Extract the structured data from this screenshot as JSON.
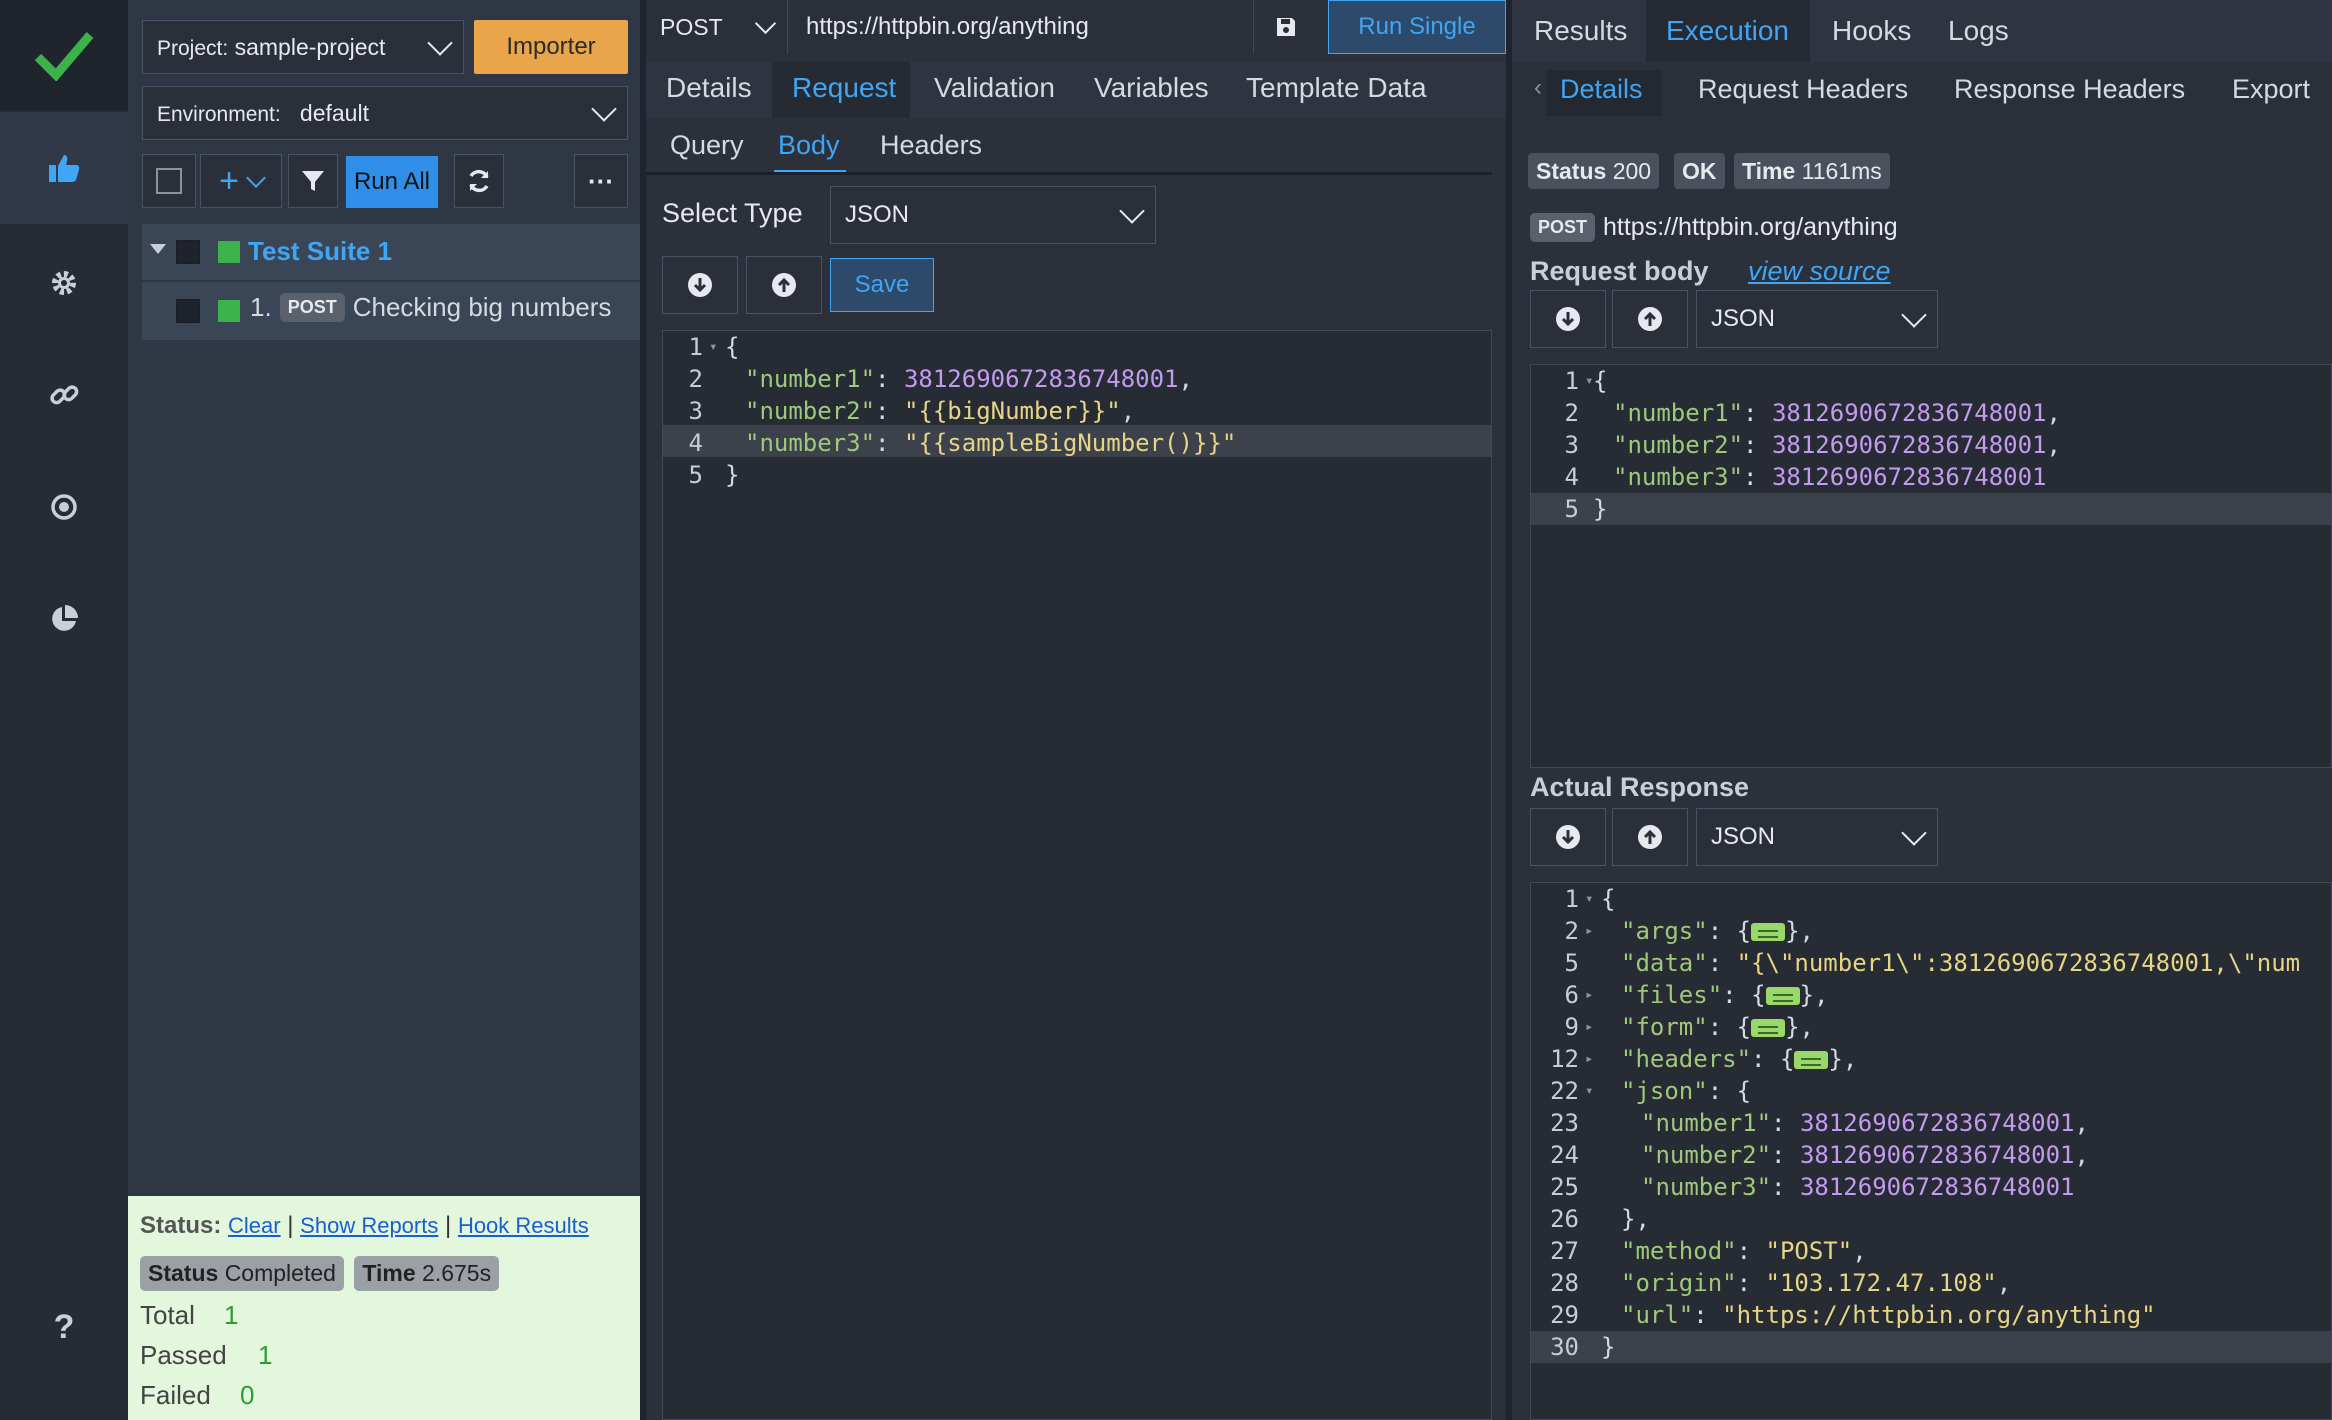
{
  "rail": {
    "icons": [
      "checkmark-logo-icon",
      "thumbs-up-icon",
      "gear-icon",
      "link-icon",
      "target-icon",
      "pie-chart-icon",
      "help-icon"
    ]
  },
  "explorer": {
    "project_label": "Project:",
    "project_value": "sample-project",
    "importer_label": "Importer",
    "environment_label": "Environment:",
    "environment_value": "default",
    "run_all_label": "Run All",
    "suite_name": "Test Suite 1",
    "tests": [
      {
        "index": "1.",
        "method": "POST",
        "name": "Checking big numbers"
      }
    ]
  },
  "status": {
    "title": "Status:",
    "links": [
      "Clear",
      "Show Reports",
      "Hook Results"
    ],
    "separator": "|",
    "status_label": "Status",
    "status_value": "Completed",
    "time_label": "Time",
    "time_value": "2.675s",
    "total_label": "Total",
    "total_value": "1",
    "passed_label": "Passed",
    "passed_value": "1",
    "failed_label": "Failed",
    "failed_value": "0"
  },
  "request": {
    "method": "POST",
    "url": "https://httpbin.org/anything",
    "run_single_label": "Run Single",
    "tabs": [
      "Details",
      "Request",
      "Validation",
      "Variables",
      "Template Data"
    ],
    "active_tab": "Request",
    "subtabs": [
      "Query",
      "Body",
      "Headers"
    ],
    "active_subtab": "Body",
    "select_type_label": "Select Type",
    "select_type_value": "JSON",
    "save_label": "Save",
    "body_lines": [
      {
        "n": "1",
        "text": "{"
      },
      {
        "n": "2",
        "key": "\"number1\"",
        "val": "3812690672836748001",
        "valtype": "num",
        "tail": ","
      },
      {
        "n": "3",
        "key": "\"number2\"",
        "val": "\"{{bigNumber}}\"",
        "valtype": "str",
        "tail": ","
      },
      {
        "n": "4",
        "key": "\"number3\"",
        "val": "\"{{sampleBigNumber()}}\"",
        "valtype": "str",
        "tail": ""
      },
      {
        "n": "5",
        "text": "}"
      }
    ]
  },
  "results": {
    "tabs": [
      "Results",
      "Execution",
      "Hooks",
      "Logs"
    ],
    "active_tab": "Execution",
    "subtabs": [
      "Details",
      "Request Headers",
      "Response Headers",
      "Export"
    ],
    "active_subtab": "Details",
    "status_label": "Status",
    "status_value": "200",
    "ok_label": "OK",
    "time_label": "Time",
    "time_value": "1161ms",
    "method": "POST",
    "url": "https://httpbin.org/anything",
    "request_body_label": "Request body",
    "view_source_label": "view source",
    "body_format": "JSON",
    "request_lines": [
      {
        "n": "1",
        "text": "{"
      },
      {
        "n": "2",
        "key": "\"number1\"",
        "val": "3812690672836748001",
        "valtype": "num",
        "tail": ","
      },
      {
        "n": "3",
        "key": "\"number2\"",
        "val": "3812690672836748001",
        "valtype": "num",
        "tail": ","
      },
      {
        "n": "4",
        "key": "\"number3\"",
        "val": "3812690672836748001",
        "valtype": "num",
        "tail": ""
      },
      {
        "n": "5",
        "text": "}"
      }
    ],
    "actual_response_label": "Actual Response",
    "response_format": "JSON",
    "response_lines": [
      {
        "n": "1",
        "text": "{"
      },
      {
        "n": "2",
        "key": "\"args\"",
        "collapsed": true,
        "tail": ","
      },
      {
        "n": "5",
        "key": "\"data\"",
        "val": "\"{\\\"number1\\\":3812690672836748001,\\\"num",
        "valtype": "str",
        "tail": ""
      },
      {
        "n": "6",
        "key": "\"files\"",
        "collapsed": true,
        "tail": ","
      },
      {
        "n": "9",
        "key": "\"form\"",
        "collapsed": true,
        "tail": ","
      },
      {
        "n": "12",
        "key": "\"headers\"",
        "collapsed": true,
        "tail": ","
      },
      {
        "n": "22",
        "key": "\"json\"",
        "val": "{",
        "valtype": "p",
        "tail": ""
      },
      {
        "n": "23",
        "key": "\"number1\"",
        "val": "3812690672836748001",
        "valtype": "num",
        "tail": ",",
        "indent": 2
      },
      {
        "n": "24",
        "key": "\"number2\"",
        "val": "3812690672836748001",
        "valtype": "num",
        "tail": ",",
        "indent": 2
      },
      {
        "n": "25",
        "key": "\"number3\"",
        "val": "3812690672836748001",
        "valtype": "num",
        "tail": "",
        "indent": 2
      },
      {
        "n": "26",
        "text": "},",
        "indent": 1
      },
      {
        "n": "27",
        "key": "\"method\"",
        "val": "\"POST\"",
        "valtype": "str",
        "tail": ","
      },
      {
        "n": "28",
        "key": "\"origin\"",
        "val": "\"103.172.47.108\"",
        "valtype": "str",
        "tail": ","
      },
      {
        "n": "29",
        "key": "\"url\"",
        "val": "\"https://httpbin.org/anything\"",
        "valtype": "str",
        "tail": ""
      },
      {
        "n": "30",
        "text": "}"
      }
    ]
  },
  "colors": {
    "accent": "#3fa5f5",
    "run_button": "#2f8ee8",
    "importer": "#e8a54a",
    "pass_green": "#3cb34a",
    "status_bg": "#e3f7dd"
  }
}
